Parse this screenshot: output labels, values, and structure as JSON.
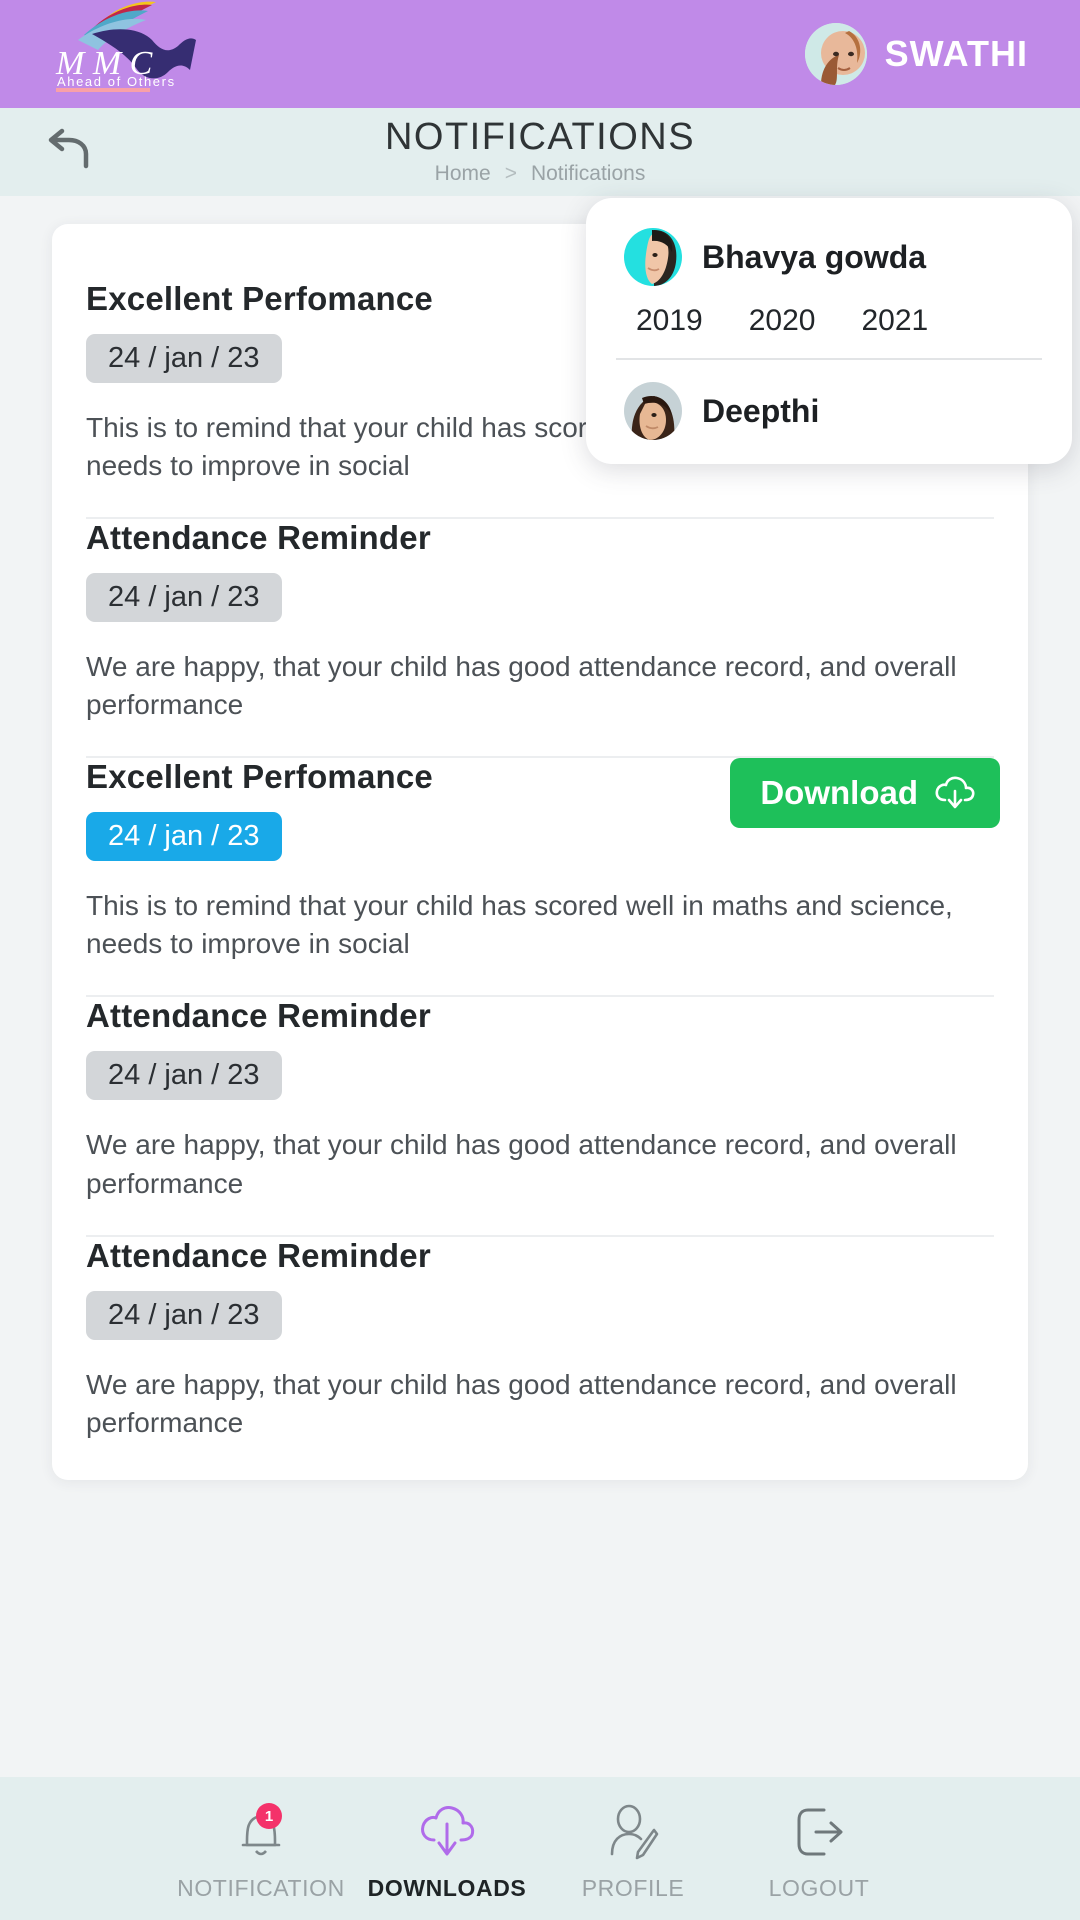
{
  "brand": {
    "name": "MMC",
    "tagline": "Ahead of Others"
  },
  "user": {
    "name": "SWATHI",
    "avatar_icon": "user-photo"
  },
  "header": {
    "back_icon": "back-arrow-icon",
    "title": "NOTIFICATIONS",
    "breadcrumb": {
      "home": "Home",
      "separator": ">",
      "current": "Notifications"
    }
  },
  "student_menu": {
    "students": [
      {
        "name": "Bhavya gowda",
        "years": [
          "2019",
          "2020",
          "2021"
        ]
      },
      {
        "name": "Deepthi",
        "years": []
      }
    ]
  },
  "notifications": [
    {
      "title": "Excellent Perfomance",
      "date": "24 / jan / 23",
      "highlighted": false,
      "body": "This is to remind that your child has scored well in maths and science, needs to improve in social",
      "download": null
    },
    {
      "title": "Attendance Reminder",
      "date": "24 / jan / 23",
      "highlighted": false,
      "body": "We are happy, that your child has good attendance record, and overall performance",
      "download": null
    },
    {
      "title": "Excellent Perfomance",
      "date": "24 / jan / 23",
      "highlighted": true,
      "body": "This is to remind that your child has scored well in maths and science, needs to improve in social",
      "download": "Download"
    },
    {
      "title": "Attendance Reminder",
      "date": "24 / jan / 23",
      "highlighted": false,
      "body": "We are happy, that your child has good attendance record, and overall performance",
      "download": null
    },
    {
      "title": "Attendance Reminder",
      "date": "24 / jan / 23",
      "highlighted": false,
      "body": "We are happy, that your child has good attendance record, and overall performance",
      "download": null
    }
  ],
  "bottom_nav": [
    {
      "label": "NOTIFICATION",
      "icon": "bell-icon",
      "badge": "1",
      "active": false
    },
    {
      "label": "DOWNLOADS",
      "icon": "cloud-download-icon",
      "badge": "",
      "active": true
    },
    {
      "label": "PROFILE",
      "icon": "profile-edit-icon",
      "badge": "",
      "active": false
    },
    {
      "label": "LOGOUT",
      "icon": "logout-icon",
      "badge": "",
      "active": false
    }
  ],
  "colors": {
    "brand_bar": "#c08ae8",
    "header_bar": "#e3eeee",
    "download_green": "#1ec05a",
    "badge_blue": "#19a9e8",
    "badge_red": "#f4326a",
    "nav_active_purple": "#b06bea"
  }
}
